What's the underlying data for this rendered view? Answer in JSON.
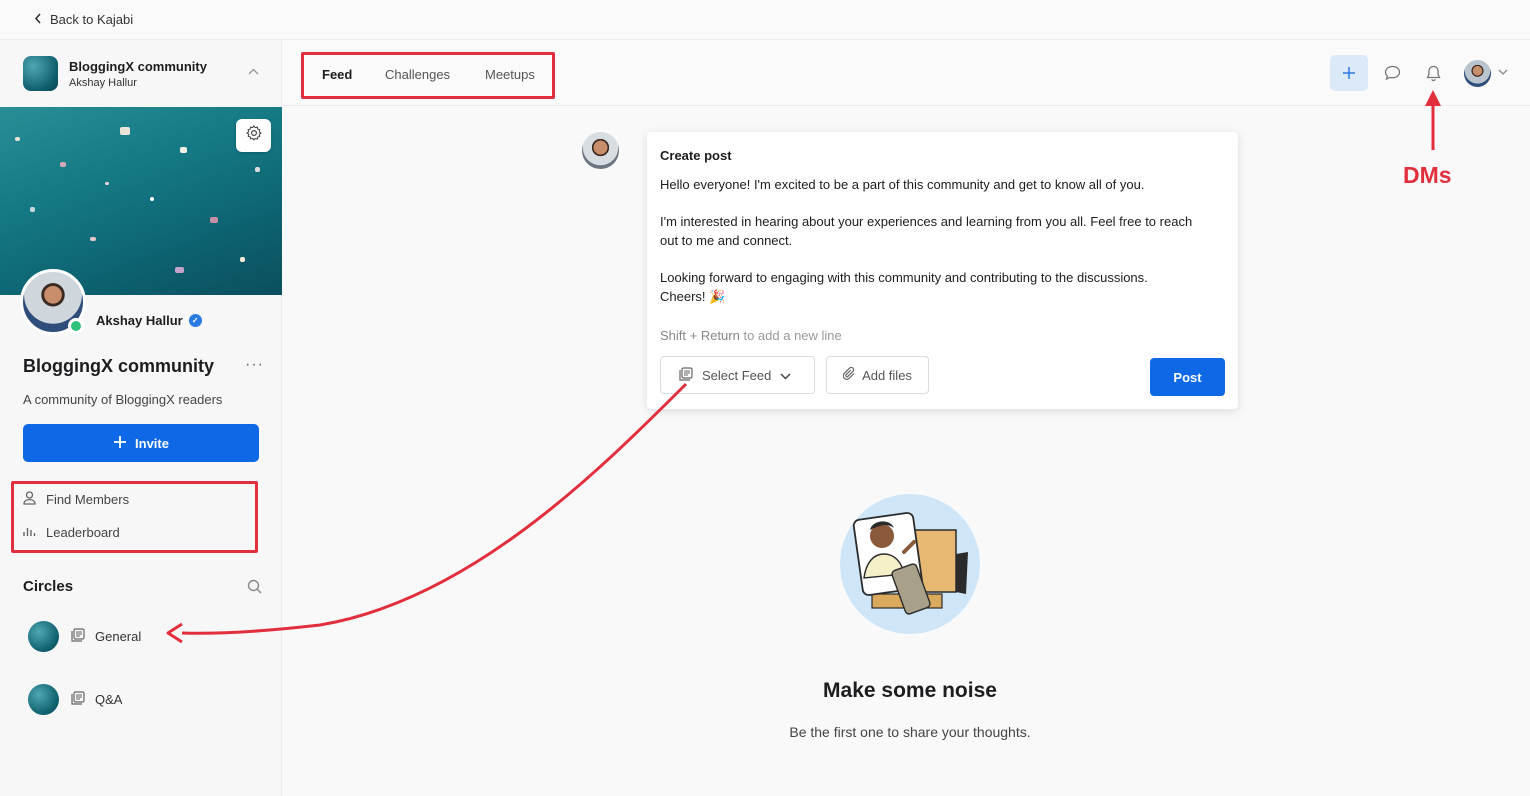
{
  "topbar": {
    "back_label": "Back to Kajabi"
  },
  "community": {
    "name": "BloggingX community",
    "owner": "Akshay Hallur",
    "profile_name": "Akshay Hallur",
    "title": "BloggingX community",
    "description": "A community of BloggingX readers",
    "invite_label": "Invite"
  },
  "sidebar_links": [
    {
      "label": "Find Members",
      "icon": "person-icon"
    },
    {
      "label": "Leaderboard",
      "icon": "bar-chart-icon"
    }
  ],
  "circles": {
    "title": "Circles",
    "items": [
      {
        "label": "General"
      },
      {
        "label": "Q&A"
      }
    ]
  },
  "tabs": [
    {
      "label": "Feed",
      "active": true
    },
    {
      "label": "Challenges",
      "active": false
    },
    {
      "label": "Meetups",
      "active": false
    }
  ],
  "annotation": {
    "dms_label": "DMs",
    "color": "#e22f3d"
  },
  "post": {
    "title": "Create post",
    "para1": "Hello everyone! I'm excited to be a part of this community and get to know all of you.",
    "para2a": "I'm interested in hearing about your experiences and learning from you all. Feel free to reach",
    "para2b": "out to me and connect.",
    "para3a": "Looking forward to engaging with this community and contributing to the discussions.",
    "para3b": "Cheers! 🎉",
    "hint_keys": "Shift + Return",
    "hint_rest": " to add a new line",
    "select_feed_label": "Select Feed",
    "add_files_label": "Add files",
    "post_label": "Post"
  },
  "empty_state": {
    "title": "Make some noise",
    "subtitle": "Be the first one to share your thoughts."
  },
  "colors": {
    "accent": "#0f68e6",
    "annotation": "#e22f3d",
    "online": "#2fc27a"
  }
}
